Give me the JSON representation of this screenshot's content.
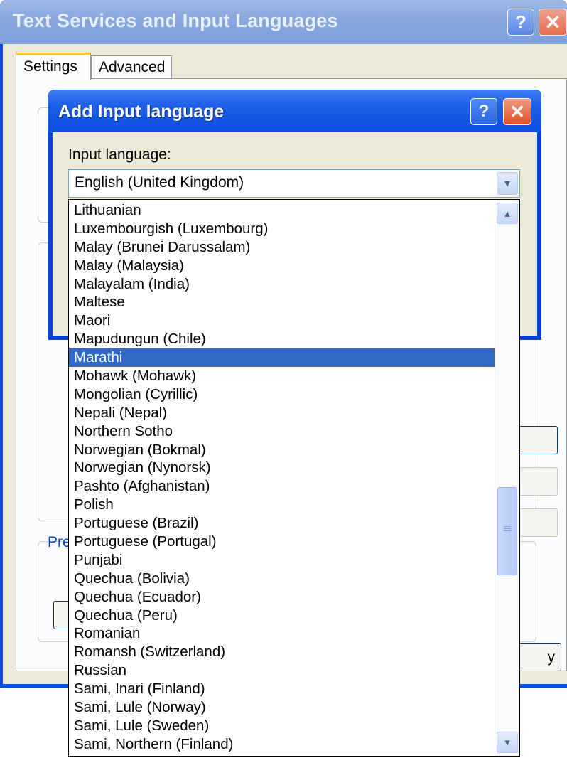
{
  "back_window": {
    "title": "Text Services and Input Languages",
    "help_label": "?",
    "close_label": "✕",
    "tabs": [
      "Settings",
      "Advanced"
    ],
    "link_text": "Pre",
    "apply_label": "y"
  },
  "dialog": {
    "title": "Add Input language",
    "help_label": "?",
    "close_label": "✕",
    "input_language_label": "Input language:",
    "combo_value": "English (United Kingdom)",
    "combo_arrow": "▾"
  },
  "dropdown": {
    "selected_index": 8,
    "items": [
      "Lithuanian",
      "Luxembourgish (Luxembourg)",
      "Malay (Brunei Darussalam)",
      "Malay (Malaysia)",
      "Malayalam (India)",
      "Maltese",
      "Maori",
      "Mapudungun (Chile)",
      "Marathi",
      "Mohawk (Mohawk)",
      "Mongolian (Cyrillic)",
      "Nepali (Nepal)",
      "Northern Sotho",
      "Norwegian (Bokmal)",
      "Norwegian (Nynorsk)",
      "Pashto (Afghanistan)",
      "Polish",
      "Portuguese (Brazil)",
      "Portuguese (Portugal)",
      "Punjabi",
      "Quechua (Bolivia)",
      "Quechua (Ecuador)",
      "Quechua (Peru)",
      "Romanian",
      "Romansh (Switzerland)",
      "Russian",
      "Sami, Inari (Finland)",
      "Sami, Lule (Norway)",
      "Sami, Lule (Sweden)",
      "Sami, Northern (Finland)"
    ],
    "scroll_up": "▴",
    "scroll_down": "▾"
  }
}
